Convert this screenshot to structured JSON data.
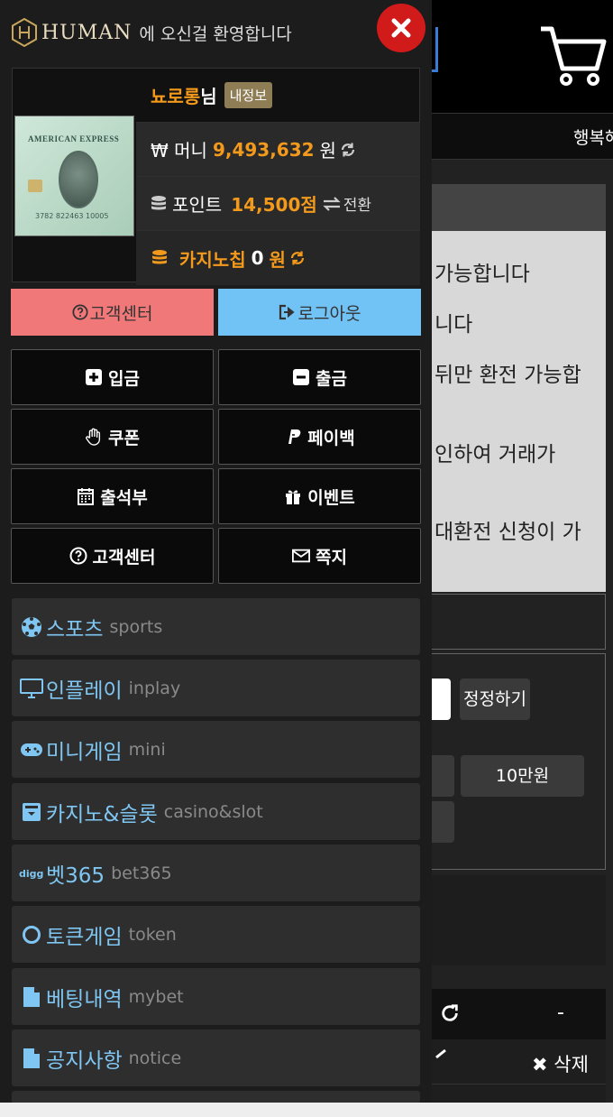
{
  "background": {
    "nav_item": "행복해",
    "notice_lines": [
      "가능합니다",
      "니다",
      "뒤만 환전 가능합",
      "인하여 거래가",
      "대환전 신청이 가"
    ],
    "fix_button": "정정하기",
    "amount_button": "10만원",
    "row_dash": "-",
    "delete_label": "삭제"
  },
  "drawer": {
    "brand": "HUMAN",
    "welcome_msg": "에 오신걸 환영합니다",
    "close_icon": "close-icon",
    "user": {
      "nickname": "뇨로롱",
      "suffix": "님",
      "my_info_badge": "내정보"
    },
    "card": {
      "brand_text": "AMERICAN EXPRESS",
      "number_text": "3782 822463 10005"
    },
    "money": {
      "label": "₩ 머니",
      "value": "9,493,632",
      "unit": "원"
    },
    "point": {
      "label": "포인트",
      "value": "14,500점",
      "convert_label": "전환"
    },
    "casino_chip": {
      "label": "카지노칩",
      "value": "0",
      "unit": "원"
    },
    "customer_center": "고객센터",
    "logout": "로그아웃",
    "grid": {
      "deposit": "입금",
      "withdraw": "출금",
      "coupon": "쿠폰",
      "payback": "페이백",
      "attendance": "출석부",
      "event": "이벤트",
      "support": "고객센터",
      "message": "쪽지"
    },
    "menu": [
      {
        "kr": "스포츠",
        "en": "sports",
        "icon": "soccer-ball-icon"
      },
      {
        "kr": "인플레이",
        "en": "inplay",
        "icon": "monitor-icon"
      },
      {
        "kr": "미니게임",
        "en": "mini",
        "icon": "gamepad-icon"
      },
      {
        "kr": "카지노&슬롯",
        "en": "casino&slot",
        "icon": "slot-icon"
      },
      {
        "kr": "벳365",
        "en": "bet365",
        "icon": "digg-icon"
      },
      {
        "kr": "토큰게임",
        "en": "token",
        "icon": "circle-icon"
      },
      {
        "kr": "베팅내역",
        "en": "mybet",
        "icon": "file-icon"
      },
      {
        "kr": "공지사항",
        "en": "notice",
        "icon": "file-icon"
      }
    ],
    "colors": {
      "accent_orange": "#f39a1c",
      "menu_blue": "#7fc6f2",
      "customer_btn": "#f07878",
      "logout_btn": "#71c3f5",
      "close_red": "#d11a1a"
    }
  }
}
